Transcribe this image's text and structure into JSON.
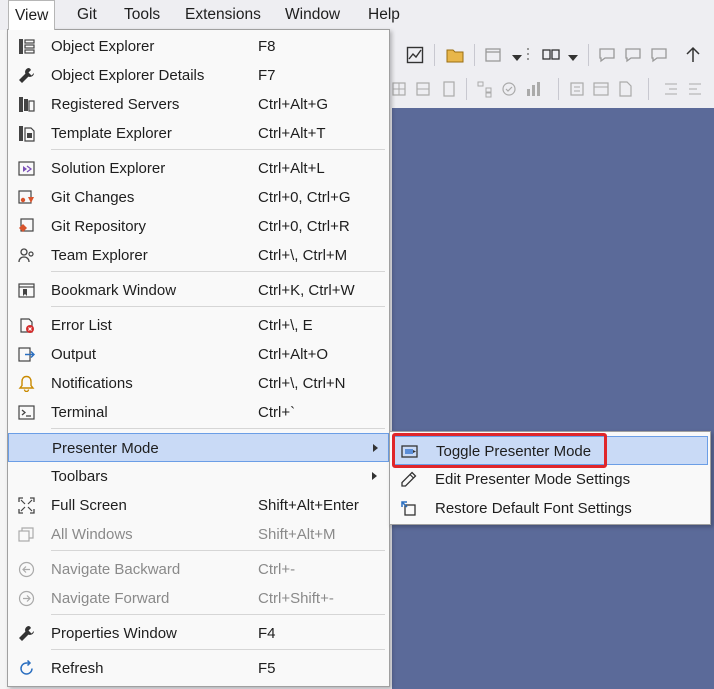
{
  "menubar": {
    "items": [
      "View",
      "Git",
      "Tools",
      "Extensions",
      "Window",
      "Help"
    ]
  },
  "view_menu": {
    "items": [
      {
        "label": "Object Explorer",
        "shortcut": "F8",
        "icon": "object-explorer-icon"
      },
      {
        "label": "Object Explorer Details",
        "shortcut": "F7",
        "icon": "wrench-icon"
      },
      {
        "label": "Registered Servers",
        "shortcut": "Ctrl+Alt+G",
        "icon": "registered-servers-icon"
      },
      {
        "label": "Template Explorer",
        "shortcut": "Ctrl+Alt+T",
        "icon": "template-explorer-icon"
      },
      {
        "label": "Solution Explorer",
        "shortcut": "Ctrl+Alt+L",
        "icon": "solution-explorer-icon"
      },
      {
        "label": "Git Changes",
        "shortcut": "Ctrl+0, Ctrl+G",
        "icon": "git-changes-icon"
      },
      {
        "label": "Git Repository",
        "shortcut": "Ctrl+0, Ctrl+R",
        "icon": "git-repository-icon"
      },
      {
        "label": "Team Explorer",
        "shortcut": "Ctrl+\\, Ctrl+M",
        "icon": "team-explorer-icon"
      },
      {
        "label": "Bookmark Window",
        "shortcut": "Ctrl+K, Ctrl+W",
        "icon": "bookmark-window-icon"
      },
      {
        "label": "Error List",
        "shortcut": "Ctrl+\\, E",
        "icon": "error-list-icon"
      },
      {
        "label": "Output",
        "shortcut": "Ctrl+Alt+O",
        "icon": "output-icon"
      },
      {
        "label": "Notifications",
        "shortcut": "Ctrl+\\, Ctrl+N",
        "icon": "bell-icon"
      },
      {
        "label": "Terminal",
        "shortcut": "Ctrl+`",
        "icon": "terminal-icon"
      },
      {
        "label": "Presenter Mode",
        "shortcut": "",
        "icon": ""
      },
      {
        "label": "Toolbars",
        "shortcut": "",
        "icon": ""
      },
      {
        "label": "Full Screen",
        "shortcut": "Shift+Alt+Enter",
        "icon": "full-screen-icon"
      },
      {
        "label": "All Windows",
        "shortcut": "Shift+Alt+M",
        "icon": "all-windows-icon"
      },
      {
        "label": "Navigate Backward",
        "shortcut": "Ctrl+-",
        "icon": "navigate-backward-icon"
      },
      {
        "label": "Navigate Forward",
        "shortcut": "Ctrl+Shift+-",
        "icon": "navigate-forward-icon"
      },
      {
        "label": "Properties Window",
        "shortcut": "F4",
        "icon": "wrench-icon"
      },
      {
        "label": "Refresh",
        "shortcut": "F5",
        "icon": "refresh-icon"
      }
    ]
  },
  "presenter_submenu": {
    "items": [
      {
        "label": "Toggle Presenter Mode",
        "icon": "presenter-mode-icon"
      },
      {
        "label": "Edit Presenter Mode Settings",
        "icon": "pencil-icon"
      },
      {
        "label": "Restore Default Font Settings",
        "icon": "restore-icon"
      }
    ]
  },
  "colors": {
    "highlight": "#c9daf6",
    "highlight_border": "#6b9ee6",
    "callout_border": "#e0262a",
    "editor_background": "#5b6a99"
  }
}
